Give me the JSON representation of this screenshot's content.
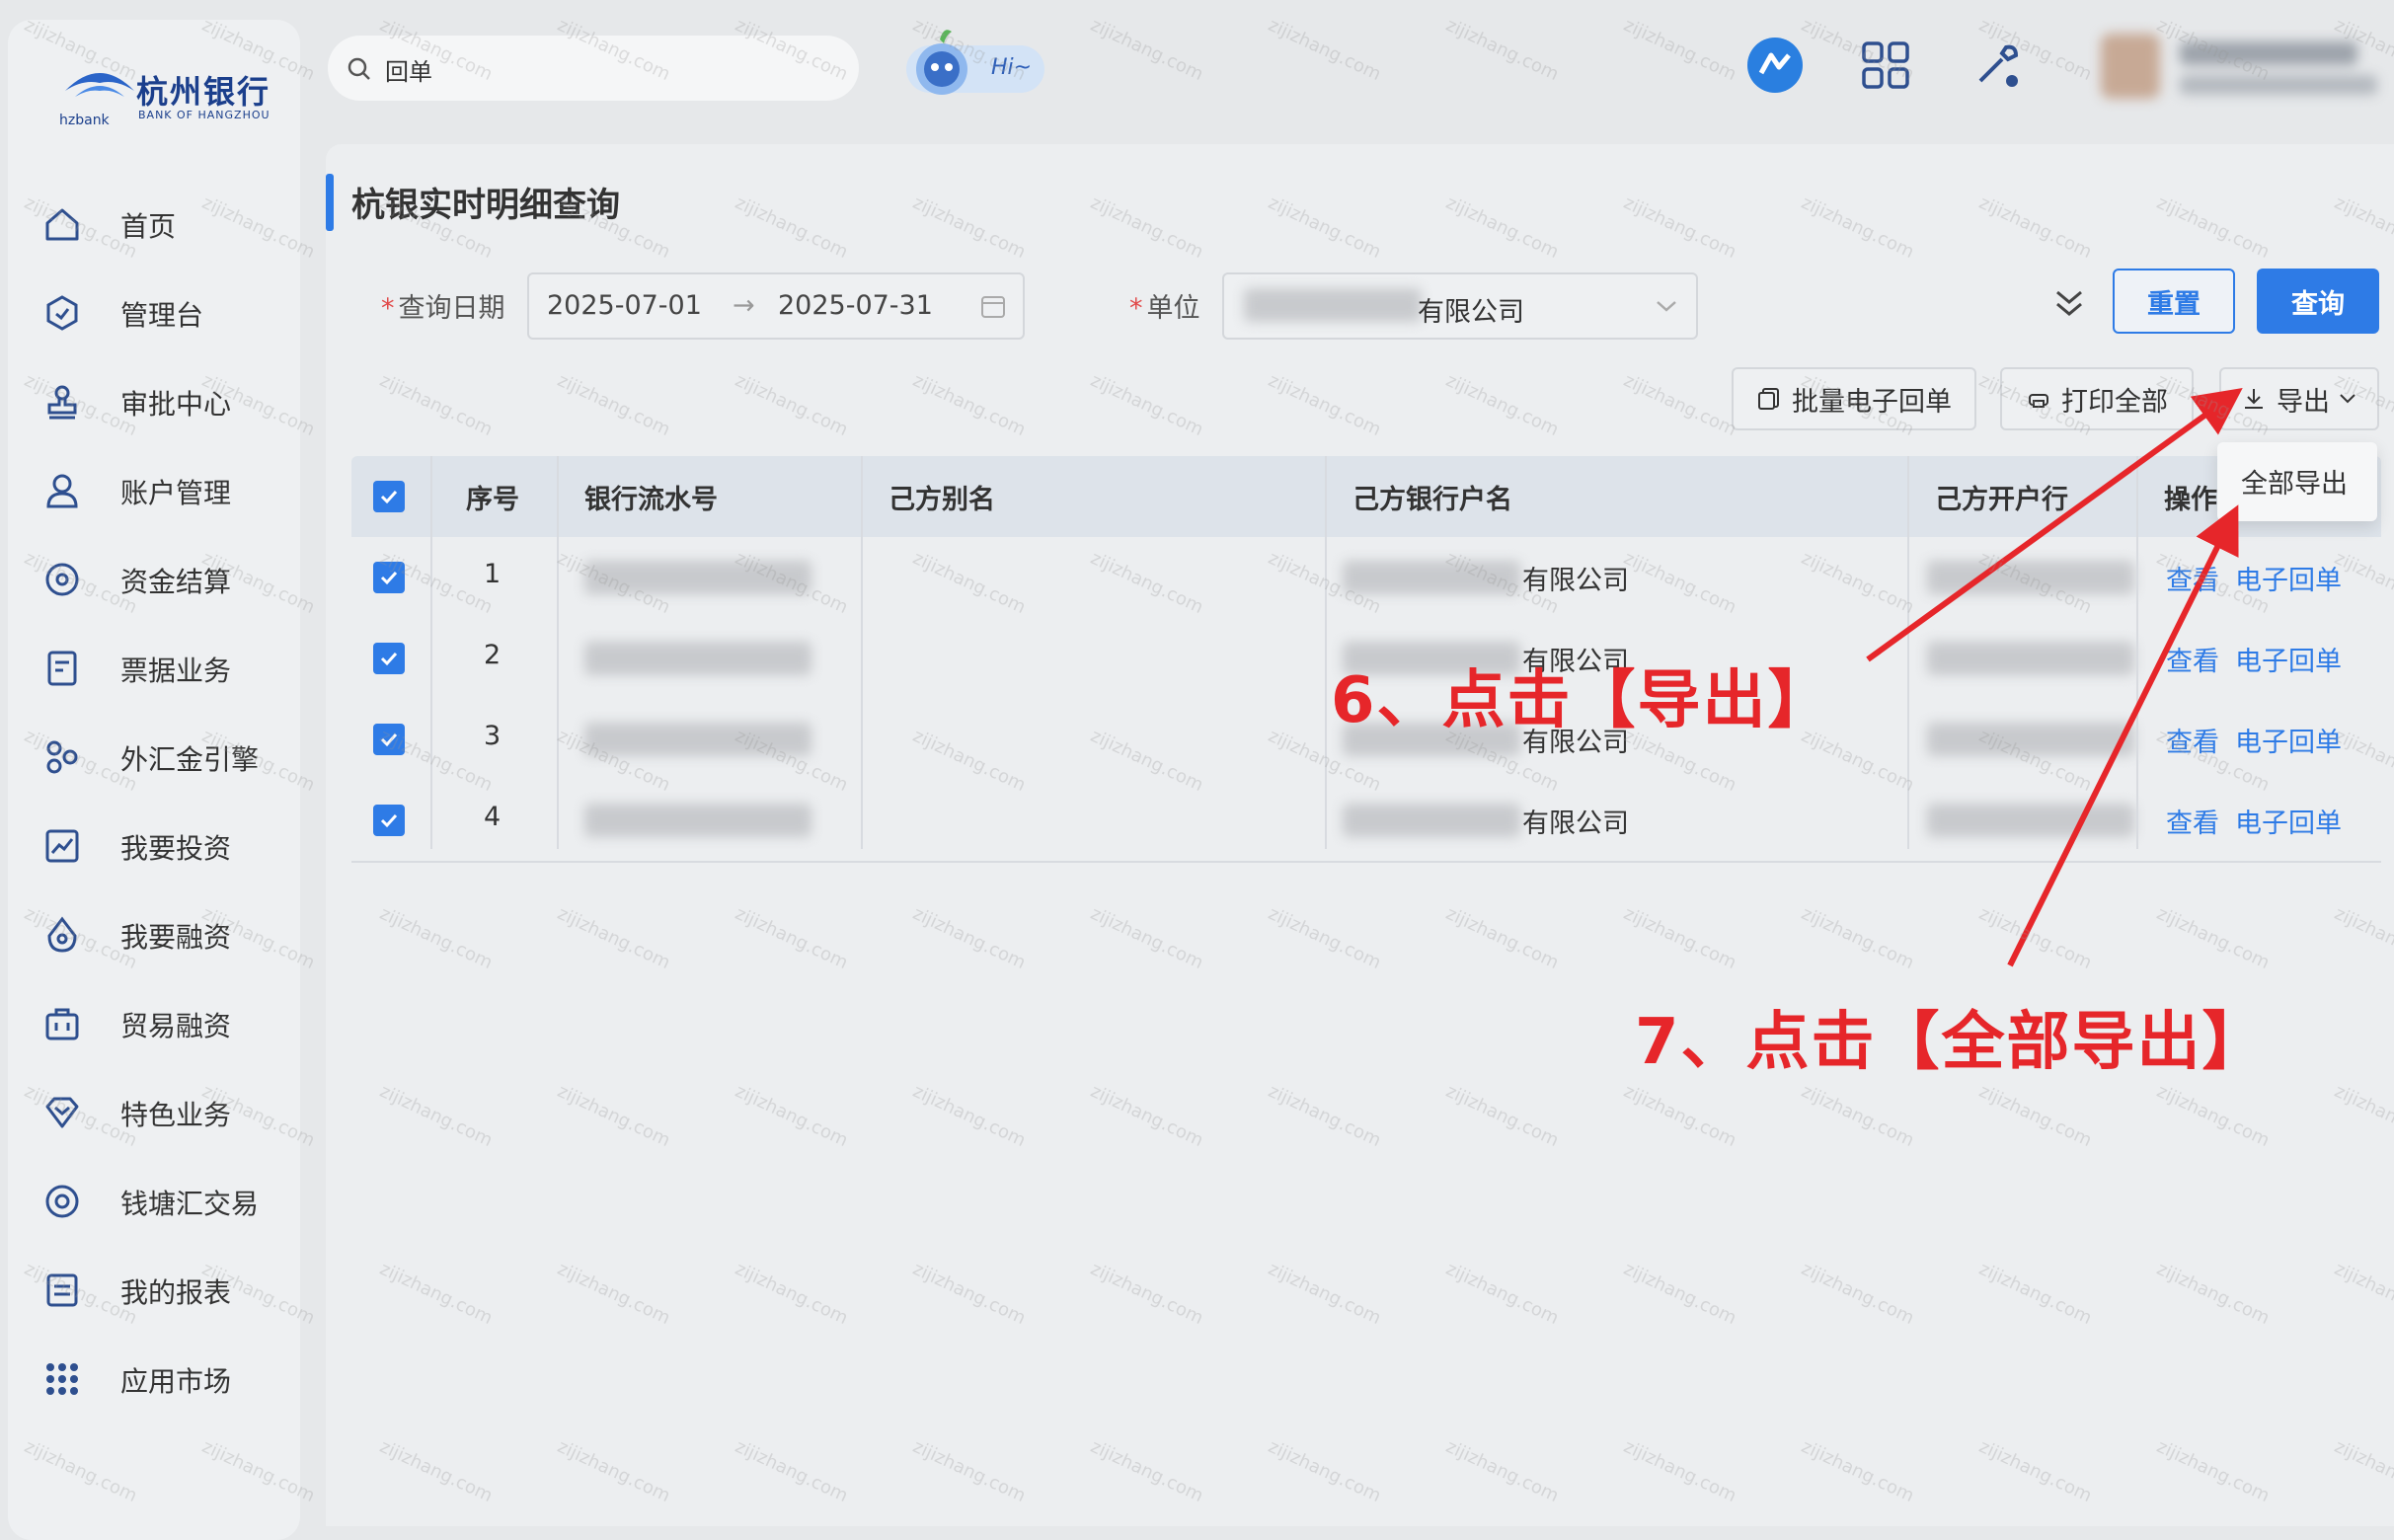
{
  "brand": {
    "name_cn": "杭州银行",
    "name_en": "BANK OF HANGZHOU",
    "short": "hzbank"
  },
  "search": {
    "value": "回单"
  },
  "assistant": {
    "greeting": "Hi~"
  },
  "sidebar": {
    "items": [
      {
        "label": "首页",
        "icon": "home-icon"
      },
      {
        "label": "管理台",
        "icon": "hexagon-icon"
      },
      {
        "label": "审批中心",
        "icon": "stamp-icon"
      },
      {
        "label": "账户管理",
        "icon": "user-icon"
      },
      {
        "label": "资金结算",
        "icon": "target-icon"
      },
      {
        "label": "票据业务",
        "icon": "document-icon"
      },
      {
        "label": "外汇金引擎",
        "icon": "cluster-icon"
      },
      {
        "label": "我要投资",
        "icon": "chart-up-icon"
      },
      {
        "label": "我要融资",
        "icon": "drop-icon"
      },
      {
        "label": "贸易融资",
        "icon": "briefcase-icon"
      },
      {
        "label": "特色业务",
        "icon": "diamond-icon"
      },
      {
        "label": "钱塘汇交易",
        "icon": "circle-dot-icon"
      },
      {
        "label": "我的报表",
        "icon": "report-icon"
      },
      {
        "label": "应用市场",
        "icon": "grid-dots-icon"
      }
    ]
  },
  "page": {
    "title": "杭银实时明细查询"
  },
  "filters": {
    "date_label": "查询日期",
    "date_start": "2025-07-01",
    "date_sep": "→",
    "date_end": "2025-07-31",
    "unit_label": "单位",
    "unit_value": "有限公司",
    "required_mark": "*"
  },
  "actions": {
    "reset": "重置",
    "query": "查询",
    "batch_receipt": "批量电子回单",
    "print_all": "打印全部",
    "export": "导出",
    "export_all": "全部导出"
  },
  "table": {
    "headers": [
      "序号",
      "银行流水号",
      "己方别名",
      "己方银行户名",
      "己方开户行",
      "操作"
    ],
    "rows": [
      {
        "index": "1",
        "account_name": "有限公司",
        "view": "查看",
        "receipt": "电子回单"
      },
      {
        "index": "2",
        "account_name": "有限公司",
        "view": "查看",
        "receipt": "电子回单"
      },
      {
        "index": "3",
        "account_name": "有限公司",
        "view": "查看",
        "receipt": "电子回单"
      },
      {
        "index": "4",
        "account_name": "有限公司",
        "view": "查看",
        "receipt": "电子回单"
      }
    ]
  },
  "annotations": {
    "step6": "6、点击【导出】",
    "step7": "7、点击【全部导出】",
    "color": "#e6262a"
  },
  "watermark": "zijizhang.com",
  "colors": {
    "accent": "#2e7be6",
    "annotation": "#e6262a",
    "brand": "#1b3f8c"
  }
}
